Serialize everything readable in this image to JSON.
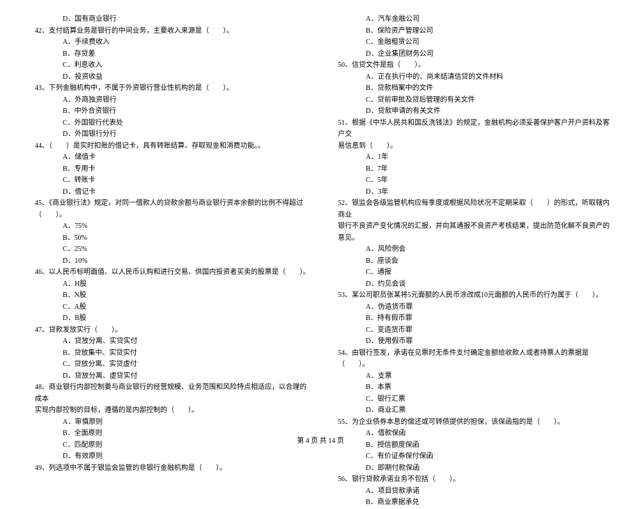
{
  "footer": "第 4 页 共 14 页",
  "left_column": [
    {
      "type": "option",
      "text": "D．国有商业银行"
    },
    {
      "type": "question",
      "text": "42、支付结算业务是银行的中间业务，主要收入来源是（　　）。"
    },
    {
      "type": "option",
      "text": "A．手续费收入"
    },
    {
      "type": "option",
      "text": "B．存贷差"
    },
    {
      "type": "option",
      "text": "C．利息收入"
    },
    {
      "type": "option",
      "text": "D．投资收益"
    },
    {
      "type": "question",
      "text": "43、下列金融机构中，不属于外资银行营业性机构的是（　　）。"
    },
    {
      "type": "option",
      "text": "A．外商独资银行"
    },
    {
      "type": "option",
      "text": "B．中外合资银行"
    },
    {
      "type": "option",
      "text": "C．外国银行代表处"
    },
    {
      "type": "option",
      "text": "D．外国银行分行"
    },
    {
      "type": "question",
      "text": "44、（　　）是实时扣账的借记卡，具有转账结算、存取现金和消费功能。。"
    },
    {
      "type": "option",
      "text": "A．储值卡"
    },
    {
      "type": "option",
      "text": "B．专用卡"
    },
    {
      "type": "option",
      "text": "C．转账卡"
    },
    {
      "type": "option",
      "text": "D．借记卡"
    },
    {
      "type": "question",
      "text": "45、《商业银行法》规定，对同一借款人的贷款余额与商业银行资本余额的比例不得超过"
    },
    {
      "type": "continuation",
      "text": "（　　）。"
    },
    {
      "type": "option",
      "text": "A．75%"
    },
    {
      "type": "option",
      "text": "B．50%"
    },
    {
      "type": "option",
      "text": "C．25%"
    },
    {
      "type": "option",
      "text": "D．10%"
    },
    {
      "type": "question",
      "text": "46、以人民币标明面值、以人民币认购和进行交易、供国内投资者买卖的股票是（　　）。"
    },
    {
      "type": "option",
      "text": "A．H股"
    },
    {
      "type": "option",
      "text": "B．N股"
    },
    {
      "type": "option",
      "text": "C．A股"
    },
    {
      "type": "option",
      "text": "D．B股"
    },
    {
      "type": "question",
      "text": "47、贷款发放实行（　　）。"
    },
    {
      "type": "option",
      "text": "A．贷放分离、实贷实付"
    },
    {
      "type": "option",
      "text": "B．贷放集中、实贷实付"
    },
    {
      "type": "option",
      "text": "C．贷放分离、实贷虚付"
    },
    {
      "type": "option",
      "text": "D．贷放分离、虚贷实付"
    },
    {
      "type": "question",
      "text": "48、商业银行内部控制要与商业银行的经营规模、业务范围和风险特点相适应，以合理的成本"
    },
    {
      "type": "continuation",
      "text": "实现内部控制的目标，遵循的是内部控制的（　　）。"
    },
    {
      "type": "option",
      "text": "A．审慎原则"
    },
    {
      "type": "option",
      "text": "B．全面原则"
    },
    {
      "type": "option",
      "text": "C．匹配原则"
    },
    {
      "type": "option",
      "text": "D．有效原则"
    },
    {
      "type": "question",
      "text": "49、列选项中不属于银监会监管的非银行金融机构是（　　）。"
    }
  ],
  "right_column": [
    {
      "type": "option",
      "text": "A．汽车金融公司"
    },
    {
      "type": "option",
      "text": "B．保险资产管理公司"
    },
    {
      "type": "option",
      "text": "C．金融租赁公司"
    },
    {
      "type": "option",
      "text": "D．企业集团财务公司"
    },
    {
      "type": "question",
      "text": "50、信贷文件是指（　　）。"
    },
    {
      "type": "option",
      "text": "A．正在执行中的、尚未结清信贷的文件材料"
    },
    {
      "type": "option",
      "text": "B．贷款档案中的文件"
    },
    {
      "type": "option",
      "text": "C．贷前审批及贷后管理的有关文件"
    },
    {
      "type": "option",
      "text": "D．贷款申请的有关文件"
    },
    {
      "type": "question",
      "text": "51、根据《中华人民共和国反洗钱法》的规定，金融机构必须妥善保护客户开户资料及客户交"
    },
    {
      "type": "continuation",
      "text": "易信息到（　　）。"
    },
    {
      "type": "option",
      "text": "A．1年"
    },
    {
      "type": "option",
      "text": "B．7年"
    },
    {
      "type": "option",
      "text": "C．5年"
    },
    {
      "type": "option",
      "text": "D．3年"
    },
    {
      "type": "question",
      "text": "52、银监会各级监管机构应每季度或根据风险状况不定期采取（　　）的形式，听取辖内商业"
    },
    {
      "type": "continuation",
      "text": "银行不良资产变化情况的汇报，并向其通报不良资产考核结果，提出防范化解不良资产的意见。"
    },
    {
      "type": "option",
      "text": "A．风险例会"
    },
    {
      "type": "option",
      "text": "B．座谈会"
    },
    {
      "type": "option",
      "text": "C．通报"
    },
    {
      "type": "option",
      "text": "D．约见会谈"
    },
    {
      "type": "question",
      "text": "53、某公司职员张某将5元面额的人民币涂改成10元面额的人民币的行为属于（　　）。"
    },
    {
      "type": "option",
      "text": "A．伪造货币罪"
    },
    {
      "type": "option",
      "text": "B．持有假币罪"
    },
    {
      "type": "option",
      "text": "C．变造货币罪"
    },
    {
      "type": "option",
      "text": "D．使用假币罪"
    },
    {
      "type": "question",
      "text": "54、由银行签发，承诺在见票时无条件支付确定金额给收款人或者持票人的票据是（　　）。"
    },
    {
      "type": "option",
      "text": "A．支票"
    },
    {
      "type": "option",
      "text": "B．本票"
    },
    {
      "type": "option",
      "text": "C．银行汇票"
    },
    {
      "type": "option",
      "text": "D．商业汇票"
    },
    {
      "type": "question",
      "text": "55、为企业债券本息的偿还或可转债提供的担保，该保函指的是（　　）。"
    },
    {
      "type": "option",
      "text": "A．借款保函"
    },
    {
      "type": "option",
      "text": "B．授信额度保函"
    },
    {
      "type": "option",
      "text": "C．有价证券保付保函"
    },
    {
      "type": "option",
      "text": "D．即期付款保函"
    },
    {
      "type": "question",
      "text": "56、银行贷款承诺业务不包括（　　）。"
    },
    {
      "type": "option",
      "text": "A．项目贷款承诺"
    },
    {
      "type": "option",
      "text": "B．商业票据承兑"
    }
  ]
}
